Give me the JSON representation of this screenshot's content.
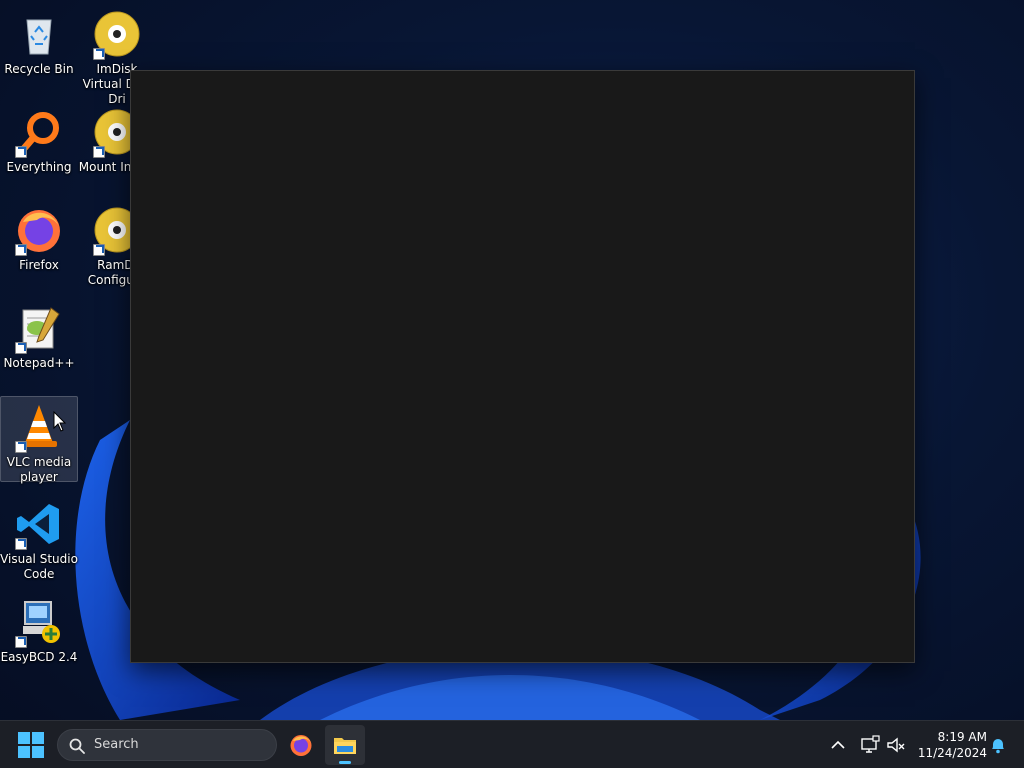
{
  "desktop": {
    "icons": [
      {
        "label": "Recycle Bin",
        "icon": "recycle-bin-icon"
      },
      {
        "label": "ImDisk Virtual Disk Dri",
        "icon": "imdisk-icon"
      },
      {
        "label": "Everything",
        "icon": "everything-icon"
      },
      {
        "label": "Mount In File",
        "icon": "imdisk-icon"
      },
      {
        "label": "Firefox",
        "icon": "firefox-icon"
      },
      {
        "label": "RamDi Configura",
        "icon": "imdisk-icon"
      },
      {
        "label": "Notepad++",
        "icon": "notepadpp-icon"
      },
      {
        "label": "VLC media player",
        "icon": "vlc-icon"
      },
      {
        "label": "Visual Studio Code",
        "icon": "vscode-icon"
      },
      {
        "label": "EasyBCD 2.4",
        "icon": "easybcd-icon"
      }
    ]
  },
  "taskbar": {
    "search_label": "Search",
    "clock": {
      "time": "8:19 AM",
      "date": "11/24/2024"
    }
  },
  "colors": {
    "accent": "#4cc2ff",
    "window_bg": "#191919",
    "taskbar_bg": "#1c1f26"
  }
}
